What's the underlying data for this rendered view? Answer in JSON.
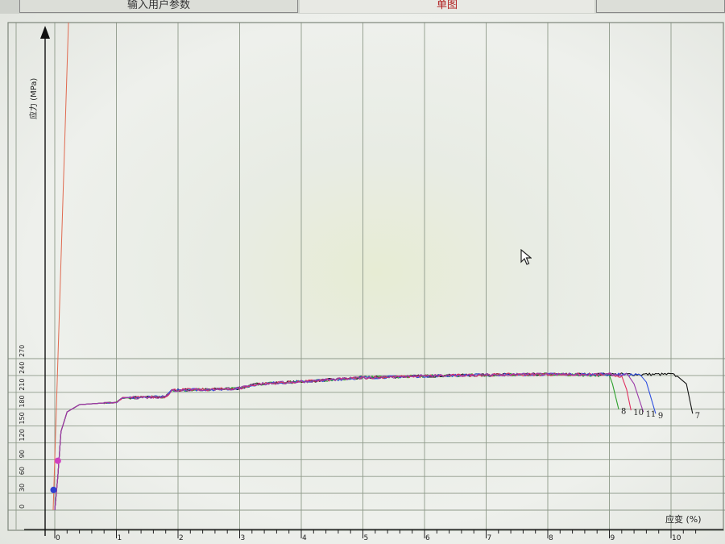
{
  "tabs": [
    {
      "label": "输入用户参数",
      "active": false
    },
    {
      "label": "单图",
      "active": true
    },
    {
      "label": "",
      "active": false
    }
  ],
  "chart_data": {
    "type": "line",
    "ylabel": "应力 (MPa)",
    "xlabel": "应变 (%)",
    "xlim": [
      0,
      10.4
    ],
    "ylim": [
      0,
      270
    ],
    "x_ticks": [
      "0",
      "1",
      "2",
      "3",
      "4",
      "5",
      "6",
      "7",
      "8",
      "9",
      "10"
    ],
    "y_ticks": [
      "0",
      "30",
      "60",
      "90",
      "120",
      "150",
      "180",
      "210",
      "240",
      "270"
    ],
    "grid": true,
    "series": [
      {
        "name": "7",
        "color": "#111111",
        "x": [
          0,
          0.05,
          0.1,
          0.2,
          0.4,
          0.8,
          1.0,
          1.1,
          1.5,
          1.8,
          1.9,
          2.5,
          3.0,
          3.3,
          4.0,
          5.0,
          6.0,
          7.0,
          8.0,
          9.0,
          9.5,
          10.0,
          10.1,
          10.25,
          10.35
        ],
        "y": [
          0,
          60,
          140,
          175,
          188,
          191,
          192,
          200,
          201,
          202,
          214,
          215,
          217,
          225,
          229,
          236,
          239,
          241,
          242,
          242,
          242,
          242,
          239,
          225,
          172
        ]
      },
      {
        "name": "8",
        "color": "#2aa02a",
        "x": [
          0,
          0.05,
          0.1,
          0.2,
          0.4,
          0.8,
          1.0,
          1.1,
          1.5,
          1.8,
          1.9,
          2.5,
          3.0,
          3.3,
          4.0,
          5.0,
          6.0,
          7.0,
          8.0,
          9.0,
          9.05,
          9.15
        ],
        "y": [
          0,
          60,
          140,
          175,
          188,
          191,
          192,
          200,
          201,
          202,
          214,
          215,
          217,
          225,
          229,
          236,
          239,
          241,
          242,
          240,
          225,
          180
        ]
      },
      {
        "name": "9",
        "color": "#3050e0",
        "x": [
          0,
          0.05,
          0.1,
          0.2,
          0.4,
          0.8,
          1.0,
          1.1,
          1.5,
          1.8,
          1.9,
          2.5,
          3.0,
          3.3,
          4.0,
          5.0,
          6.0,
          7.0,
          8.0,
          9.0,
          9.5,
          9.6,
          9.75
        ],
        "y": [
          0,
          60,
          140,
          175,
          188,
          191,
          192,
          200,
          201,
          202,
          214,
          215,
          217,
          225,
          229,
          236,
          239,
          241,
          242,
          242,
          241,
          228,
          172
        ]
      },
      {
        "name": "10",
        "color": "#e03060",
        "x": [
          0,
          0.05,
          0.1,
          0.2,
          0.4,
          0.8,
          1.0,
          1.1,
          1.5,
          1.8,
          1.9,
          2.5,
          3.0,
          3.3,
          4.0,
          5.0,
          6.0,
          7.0,
          8.0,
          9.0,
          9.2,
          9.28,
          9.35
        ],
        "y": [
          0,
          60,
          140,
          175,
          188,
          191,
          192,
          200,
          201,
          202,
          214,
          215,
          217,
          225,
          229,
          236,
          239,
          241,
          242,
          241,
          239,
          215,
          178
        ]
      },
      {
        "name": "11",
        "color": "#9a3aa8",
        "x": [
          0,
          0.05,
          0.1,
          0.2,
          0.4,
          0.8,
          1.0,
          1.1,
          1.5,
          1.8,
          1.9,
          2.5,
          3.0,
          3.3,
          4.0,
          5.0,
          6.0,
          7.0,
          8.0,
          9.0,
          9.3,
          9.4,
          9.55
        ],
        "y": [
          0,
          60,
          140,
          175,
          188,
          191,
          192,
          200,
          201,
          202,
          214,
          215,
          217,
          225,
          229,
          236,
          239,
          241,
          242,
          242,
          241,
          225,
          175
        ]
      }
    ],
    "markers": [
      {
        "x": -0.02,
        "y": 36,
        "color": "#3040d0"
      },
      {
        "x": 0.05,
        "y": 88,
        "color": "#d040c0"
      }
    ]
  }
}
